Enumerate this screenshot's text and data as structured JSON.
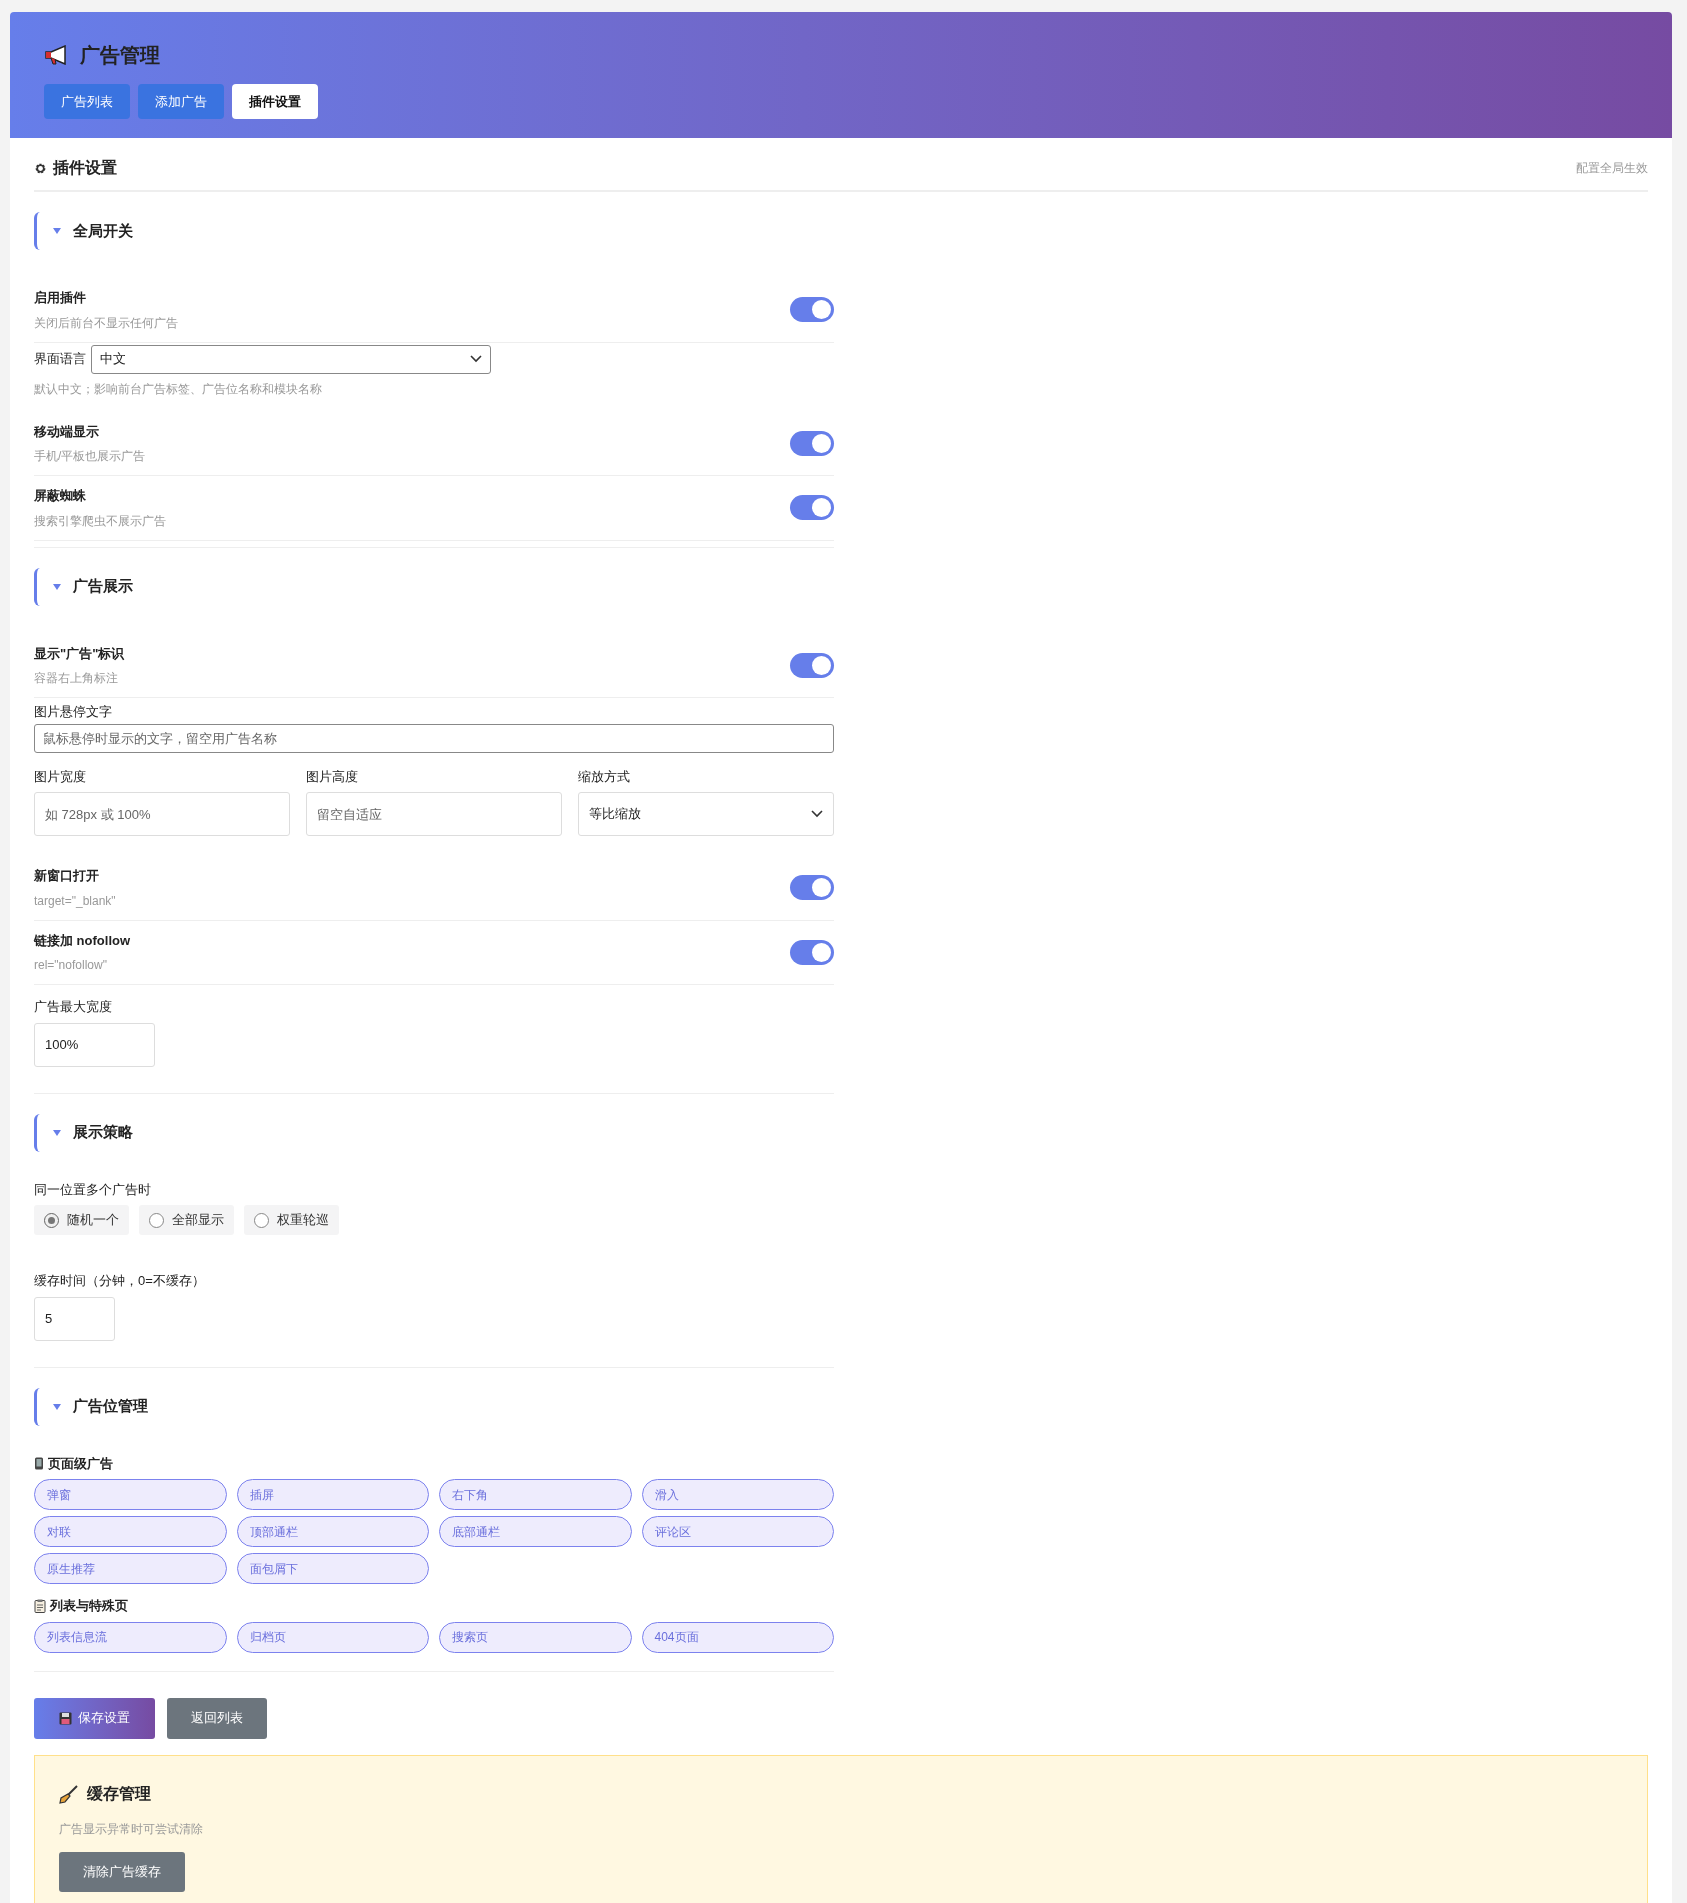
{
  "header": {
    "title": "广告管理"
  },
  "tabs": [
    {
      "label": "广告列表",
      "selected": false
    },
    {
      "label": "添加广告",
      "selected": false
    },
    {
      "label": "插件设置",
      "selected": true
    }
  ],
  "panel": {
    "title": "插件设置",
    "note": "配置全局生效"
  },
  "sections": [
    {
      "title": "全局开关",
      "rows": [
        {
          "kind": "toggle",
          "label": "启用插件",
          "description": "关闭后前台不显示任何广告",
          "on": true
        },
        {
          "kind": "inline_select",
          "label": "界面语言",
          "value": "中文",
          "hint": "默认中文；影响前台广告标签、广告位名称和模块名称"
        },
        {
          "kind": "toggle",
          "label": "移动端显示",
          "description": "手机/平板也展示广告",
          "on": true
        },
        {
          "kind": "toggle",
          "label": "屏蔽蜘蛛",
          "description": "搜索引擎爬虫不展示广告",
          "on": true
        }
      ]
    },
    {
      "title": "广告展示",
      "rows": [
        {
          "kind": "toggle",
          "label": "显示\"广告\"标识",
          "description": "容器右上角标注",
          "on": true
        },
        {
          "kind": "wide_input",
          "label": "图片悬停文字",
          "placeholder": "鼠标悬停时显示的文字，留空用广告名称"
        },
        {
          "kind": "columns",
          "fields": [
            {
              "kind": "input",
              "label": "图片宽度",
              "placeholder": "如 728px 或 100%"
            },
            {
              "kind": "input",
              "label": "图片高度",
              "placeholder": "留空自适应"
            },
            {
              "kind": "select",
              "label": "缩放方式",
              "value": "等比缩放"
            }
          ]
        },
        {
          "kind": "toggle",
          "label": "新窗口打开",
          "description": "target=\"_blank\"",
          "on": true
        },
        {
          "kind": "toggle",
          "label": "链接加 nofollow",
          "description": "rel=\"nofollow\"",
          "on": true
        },
        {
          "kind": "text_input",
          "label": "广告最大宽度",
          "value": "100%"
        }
      ]
    },
    {
      "title": "展示策略",
      "rows": [
        {
          "kind": "radio",
          "label": "同一位置多个广告时",
          "options": [
            {
              "label": "随机一个",
              "selected": true
            },
            {
              "label": "全部显示",
              "selected": false
            },
            {
              "label": "权重轮巡",
              "selected": false
            }
          ]
        },
        {
          "kind": "number_input",
          "label": "缓存时间（分钟，0=不缓存）",
          "value": "5"
        }
      ]
    },
    {
      "title": "广告位管理",
      "rows": [
        {
          "kind": "chips",
          "title": "页面级广告",
          "items": [
            {
              "label": "弹窗",
              "checked": true
            },
            {
              "label": "插屏",
              "checked": true
            },
            {
              "label": "右下角",
              "checked": true
            },
            {
              "label": "滑入",
              "checked": true
            },
            {
              "label": "对联",
              "checked": true
            },
            {
              "label": "顶部通栏",
              "checked": true
            },
            {
              "label": "底部通栏",
              "checked": true
            },
            {
              "label": "评论区",
              "checked": true
            },
            {
              "label": "原生推荐",
              "checked": true
            },
            {
              "label": "面包屑下",
              "checked": true
            }
          ]
        },
        {
          "kind": "chips",
          "title": "列表与特殊页",
          "items": [
            {
              "label": "列表信息流",
              "checked": true
            },
            {
              "label": "归档页",
              "checked": true
            },
            {
              "label": "搜索页",
              "checked": true
            },
            {
              "label": "404页面",
              "checked": true
            }
          ]
        }
      ]
    }
  ],
  "actions": [
    {
      "label": "保存设置",
      "kind": "primary"
    },
    {
      "label": "返回列表",
      "kind": "secondary"
    }
  ],
  "cache": {
    "title": "缓存管理",
    "description": "广告显示异常时可尝试清除",
    "button": "清除广告缓存"
  }
}
